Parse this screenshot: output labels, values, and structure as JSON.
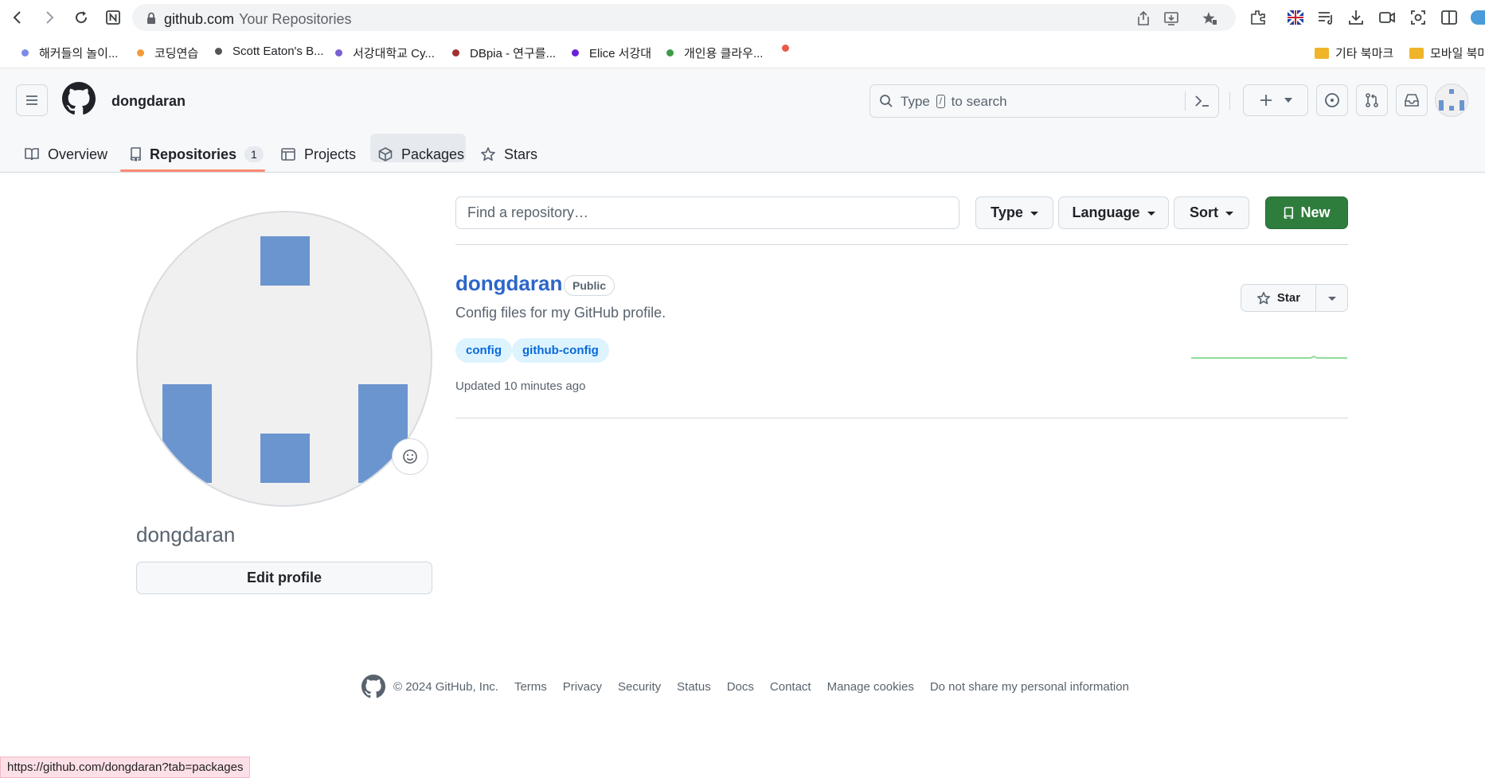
{
  "browser": {
    "url": "github.com",
    "page_title": "Your Repositories",
    "bookmarks": [
      {
        "label": "해커들의 놀이...",
        "color": "#7b8be8"
      },
      {
        "label": "코딩연습",
        "color": "#f39a3a"
      },
      {
        "label": "Scott Eaton's B...",
        "color": "#555555"
      },
      {
        "label": "서강대학교 Cy...",
        "color": "#7b5fd0"
      },
      {
        "label": "DBpia - 연구를...",
        "color": "#a23030"
      },
      {
        "label": "Elice 서강대",
        "color": "#6a21d9"
      },
      {
        "label": "개인용 클라우...",
        "color": "#3f9a48"
      },
      {
        "label": "",
        "color": "#e85a4a"
      }
    ],
    "bookmark_folders": [
      "기타 북마크",
      "모바일 북마"
    ],
    "status_url": "https://github.com/dongdaran?tab=packages"
  },
  "header": {
    "username": "dongdaran",
    "search_prefix": "Type",
    "search_key": "/",
    "search_suffix": "to search"
  },
  "tabs": [
    {
      "label": "Overview",
      "icon": "book-icon"
    },
    {
      "label": "Repositories",
      "icon": "repo-icon",
      "count": "1",
      "selected": true
    },
    {
      "label": "Projects",
      "icon": "table-icon"
    },
    {
      "label": "Packages",
      "icon": "package-icon"
    },
    {
      "label": "Stars",
      "icon": "star-icon"
    }
  ],
  "profile": {
    "name": "dongdaran",
    "edit_label": "Edit profile"
  },
  "filters": {
    "search_placeholder": "Find a repository…",
    "type_label": "Type",
    "language_label": "Language",
    "sort_label": "Sort",
    "new_label": "New"
  },
  "repos": [
    {
      "name": "dongdaran",
      "visibility": "Public",
      "description": "Config files for my GitHub profile.",
      "topics": [
        "config",
        "github-config"
      ],
      "updated": "Updated 10 minutes ago",
      "star_label": "Star"
    }
  ],
  "footer": {
    "copyright": "© 2024 GitHub, Inc.",
    "links": [
      "Terms",
      "Privacy",
      "Security",
      "Status",
      "Docs",
      "Contact",
      "Manage cookies",
      "Do not share my personal information"
    ]
  },
  "colors": {
    "accent_link": "#2c66c9",
    "new_button": "#2f7d3d",
    "tab_underline": "#fd8c73",
    "avatar_blocks": "#6b95cf"
  }
}
